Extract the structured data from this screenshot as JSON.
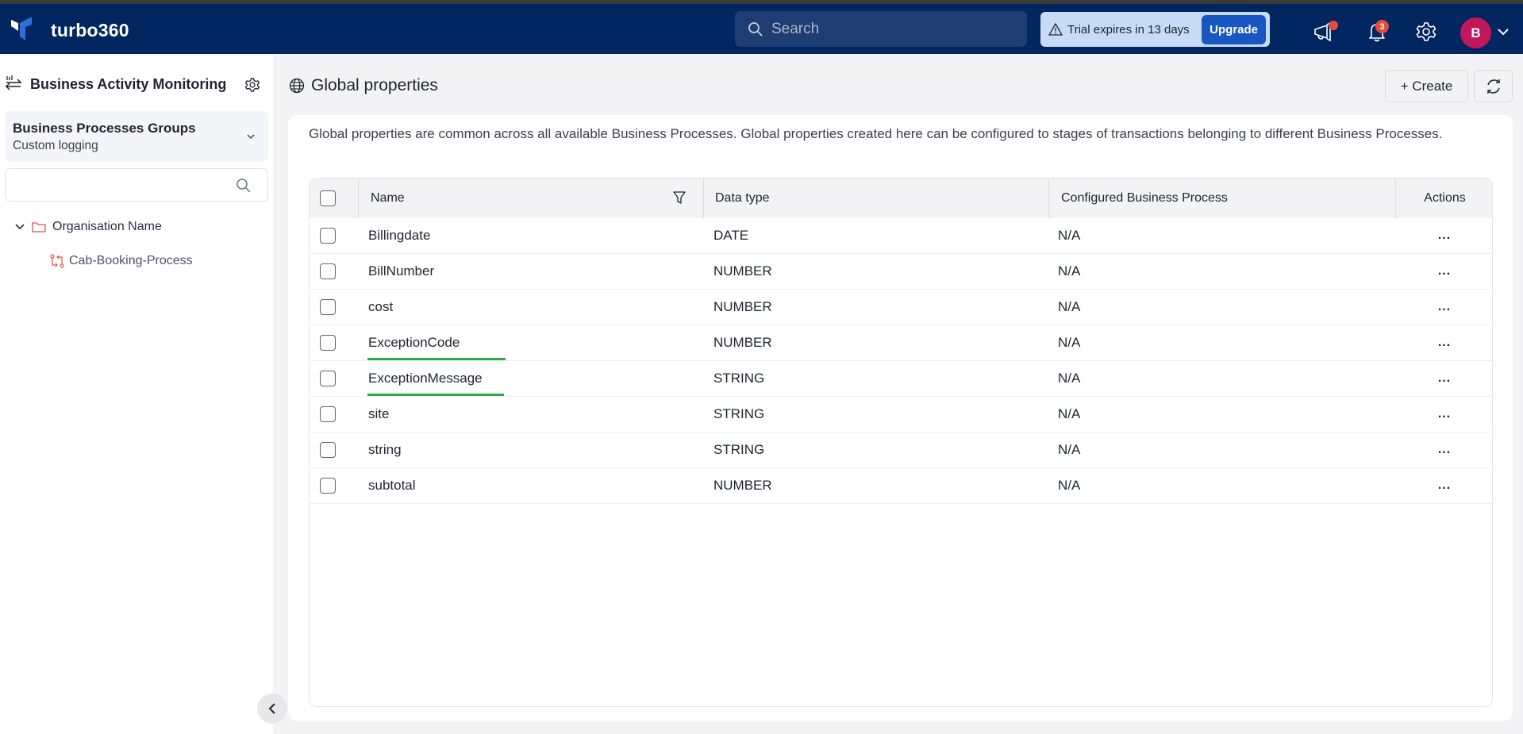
{
  "topbar": {
    "brand": "turbo360",
    "search_placeholder": "Search",
    "trial_text": "Trial expires in 13 days",
    "upgrade_label": "Upgrade",
    "notification_count": "3",
    "avatar_initial": "B",
    "colors": {
      "navy": "#012660",
      "accent": "#1856c4",
      "badge": "#e54c3c",
      "avatar": "#c2185b"
    }
  },
  "sidebar": {
    "title": "Business Activity Monitoring",
    "group": {
      "title": "Business Processes Groups",
      "subtitle": "Custom logging"
    },
    "search_placeholder": "",
    "tree": {
      "org": "Organisation Name",
      "processes": [
        "Cab-Booking-Process"
      ]
    }
  },
  "main": {
    "title": "Global properties",
    "create_label": "+ Create",
    "description": "Global properties are common across all available Business Processes. Global properties created here can be configured to stages of transactions belonging to different Business Processes.",
    "table": {
      "columns": [
        "Name",
        "Data type",
        "Configured Business Process",
        "Actions"
      ],
      "rows": [
        {
          "name": "Billingdate",
          "type": "DATE",
          "process": "N/A",
          "highlighted": false
        },
        {
          "name": "BillNumber",
          "type": "NUMBER",
          "process": "N/A",
          "highlighted": false
        },
        {
          "name": "cost",
          "type": "NUMBER",
          "process": "N/A",
          "highlighted": false
        },
        {
          "name": "ExceptionCode",
          "type": "NUMBER",
          "process": "N/A",
          "highlighted": true
        },
        {
          "name": "ExceptionMessage",
          "type": "STRING",
          "process": "N/A",
          "highlighted": true
        },
        {
          "name": "site",
          "type": "STRING",
          "process": "N/A",
          "highlighted": false
        },
        {
          "name": "string",
          "type": "STRING",
          "process": "N/A",
          "highlighted": false
        },
        {
          "name": "subtotal",
          "type": "NUMBER",
          "process": "N/A",
          "highlighted": false
        }
      ],
      "actions_label": "..."
    }
  }
}
